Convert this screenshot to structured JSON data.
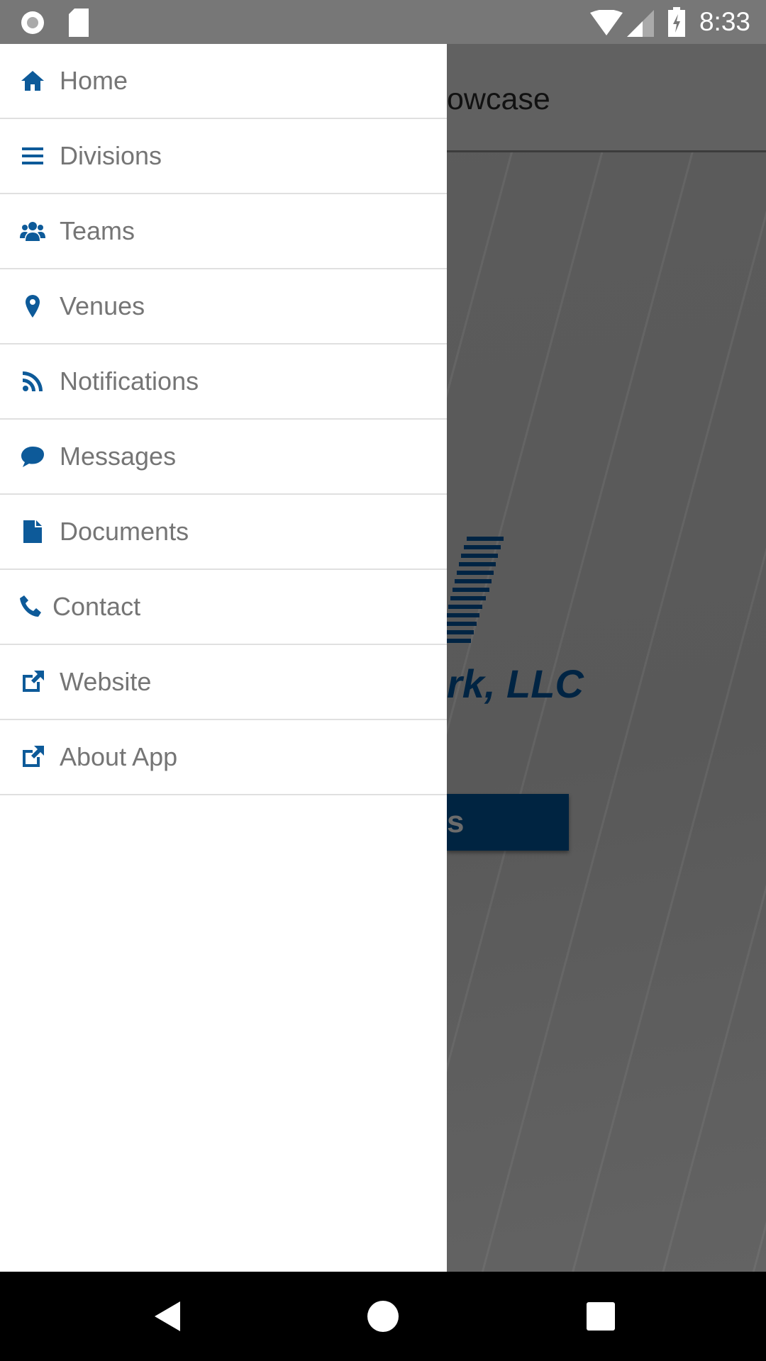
{
  "status_bar": {
    "time": "8:33",
    "icons": [
      "record-icon",
      "sd-card-icon",
      "wifi-icon",
      "signal-icon",
      "battery-charging-icon"
    ]
  },
  "toolbar": {
    "title_visible": "owcase"
  },
  "main": {
    "logo_text_visible": "rk, LLC",
    "button_label_visible": "s",
    "brand_color": "#002441"
  },
  "drawer": {
    "accent_color": "#0d5a99",
    "items": [
      {
        "label": "Home",
        "icon": "home-icon"
      },
      {
        "label": "Divisions",
        "icon": "list-icon"
      },
      {
        "label": "Teams",
        "icon": "users-icon"
      },
      {
        "label": "Venues",
        "icon": "map-marker-icon"
      },
      {
        "label": "Notifications",
        "icon": "rss-icon"
      },
      {
        "label": "Messages",
        "icon": "comment-icon"
      },
      {
        "label": "Documents",
        "icon": "file-icon"
      },
      {
        "label": "Contact",
        "icon": "phone-icon"
      },
      {
        "label": "Website",
        "icon": "external-link-icon"
      },
      {
        "label": "About App",
        "icon": "external-link-icon"
      }
    ]
  },
  "nav_bar": {
    "buttons": [
      "back-icon",
      "home-circle-icon",
      "recents-icon"
    ]
  }
}
